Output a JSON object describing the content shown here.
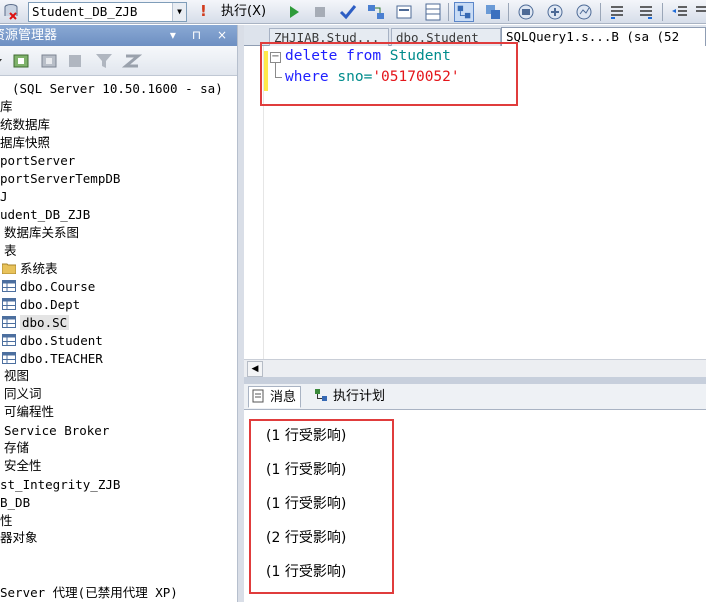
{
  "toolbar": {
    "database": "Student_DB_ZJB",
    "execute_label": "执行(X)"
  },
  "object_explorer": {
    "title": "资源管理器",
    "header_controls": "▾ ⊓ ×",
    "tree": [
      {
        "label": "(SQL Server 10.50.1600 - sa)",
        "type": "server"
      },
      {
        "label": "库",
        "type": "folder"
      },
      {
        "label": "统数据库",
        "type": "folder"
      },
      {
        "label": "据库快照",
        "type": "folder"
      },
      {
        "label": "portServer",
        "type": "db"
      },
      {
        "label": "portServerTempDB",
        "type": "db"
      },
      {
        "label": "J",
        "type": "db"
      },
      {
        "label": "udent_DB_ZJB",
        "type": "db"
      },
      {
        "label": "数据库关系图",
        "type": "folder"
      },
      {
        "label": "表",
        "type": "folder"
      },
      {
        "label": "系统表",
        "type": "folder-icon"
      },
      {
        "label": "dbo.Course",
        "type": "table"
      },
      {
        "label": "dbo.Dept",
        "type": "table"
      },
      {
        "label": "dbo.SC",
        "type": "table",
        "selected": true
      },
      {
        "label": "dbo.Student",
        "type": "table"
      },
      {
        "label": "dbo.TEACHER",
        "type": "table"
      },
      {
        "label": "视图",
        "type": "folder"
      },
      {
        "label": "同义词",
        "type": "folder"
      },
      {
        "label": "可编程性",
        "type": "folder"
      },
      {
        "label": "Service Broker",
        "type": "folder"
      },
      {
        "label": "存储",
        "type": "folder"
      },
      {
        "label": "安全性",
        "type": "folder"
      },
      {
        "label": "st_Integrity_ZJB",
        "type": "db"
      },
      {
        "label": "B_DB",
        "type": "db"
      },
      {
        "label": "性",
        "type": "folder"
      },
      {
        "label": "器对象",
        "type": "folder"
      },
      {
        "label": "Server 代理(已禁用代理 XP)",
        "type": "agent"
      }
    ]
  },
  "editor_tabs": [
    {
      "label": "ZHJIAB.Stud...",
      "active": false
    },
    {
      "label": "dbo.Student",
      "active": false
    },
    {
      "label": "SQLQuery1.s...B (sa (52",
      "active": true
    }
  ],
  "editor": {
    "line1": {
      "kw1": "delete",
      "kw2": "from",
      "table": "Student"
    },
    "line2": {
      "kw": "where",
      "cond": "sno=",
      "value": "'05170052'"
    }
  },
  "results_tabs": [
    {
      "label": "消息",
      "active": true
    },
    {
      "label": "执行计划",
      "active": false
    }
  ],
  "messages": [
    "(1 行受影响)",
    "(1 行受影响)",
    "(1 行受影响)",
    "(2 行受影响)",
    "(1 行受影响)"
  ],
  "colors": {
    "keyword": "#1f1fff",
    "identifier": "#008c8c",
    "string": "#e4151a",
    "annotation": "#e03c3c"
  }
}
